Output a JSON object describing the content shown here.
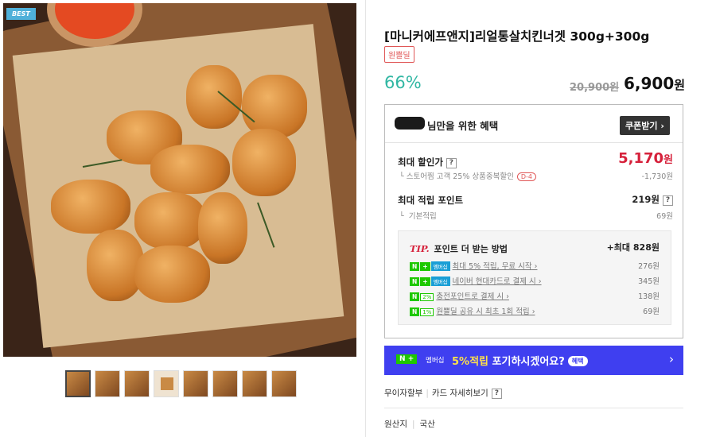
{
  "gallery": {
    "badge": "BEST",
    "thumbnail_count": 8
  },
  "product": {
    "title": "[마니커에프앤지]리얼통살치킨너겟 300g+300g",
    "tag": "원쁠딜",
    "discount": "66%",
    "original_price": "20,900원",
    "price": "6,900",
    "price_unit": "원"
  },
  "benefit": {
    "heading": "님만을 위한 혜택",
    "coupon_button": "쿠폰받기",
    "max_discount": {
      "label": "최대 할인가",
      "value": "5,170",
      "unit": "원",
      "sub_label": "스토어찜 고객 25% 상품중복할인",
      "sub_badge": "D-4",
      "sub_value": "-1,730원"
    },
    "max_points": {
      "label": "최대 적립 포인트",
      "value": "219원",
      "sub_label": "기본적립",
      "sub_value": "69원"
    },
    "tip": {
      "prefix": "TIP.",
      "title": "포인트 더 받는 방법",
      "max_label": "+최대",
      "max_value": "828원",
      "rows": [
        {
          "n": "N",
          "plus": "+",
          "member": "멤버십",
          "pct": "",
          "text": "최대 5% 적립, 무료 시작",
          "value": "276원"
        },
        {
          "n": "N",
          "plus": "+",
          "member": "멤버십",
          "pct": "",
          "text": "네이버 현대카드로 결제 시",
          "value": "345원"
        },
        {
          "n": "N",
          "plus": "",
          "member": "",
          "pct": "2%",
          "text": "충전포인트로 결제 시",
          "value": "138원"
        },
        {
          "n": "N",
          "plus": "",
          "member": "",
          "pct": "1%",
          "text": "원쁠딜 공유 시 최초 1회 적립",
          "value": "69원"
        }
      ]
    }
  },
  "banner": {
    "n": "N",
    "plus": "+",
    "member": "멤버십",
    "highlight": "5%적립",
    "text": "포기하시겠어요?",
    "pill": "혜택"
  },
  "info": {
    "installment": "무이자할부",
    "card_detail": "카드 자세히보기",
    "origin_label": "원산지",
    "origin_value": "국산"
  }
}
